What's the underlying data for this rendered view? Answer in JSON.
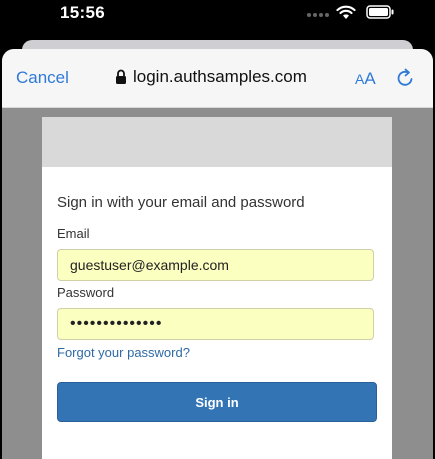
{
  "status_bar": {
    "time": "15:56",
    "icons": [
      "signal-dots-icon",
      "wifi-icon",
      "battery-icon"
    ]
  },
  "browser": {
    "cancel_label": "Cancel",
    "url": "login.authsamples.com",
    "text_size_label_small": "A",
    "text_size_label_large": "A",
    "icons": [
      "lock-icon",
      "text-size-icon",
      "reload-icon"
    ],
    "accent_color": "#2f7ad6"
  },
  "login": {
    "heading": "Sign in with your email and password",
    "email_label": "Email",
    "email_value": "guestuser@example.com",
    "password_label": "Password",
    "password_value": "••••••••••••••",
    "forgot_label": "Forgot your password?",
    "signin_label": "Sign in",
    "button_color": "#3374b5",
    "autofill_color": "#fbffc0"
  }
}
